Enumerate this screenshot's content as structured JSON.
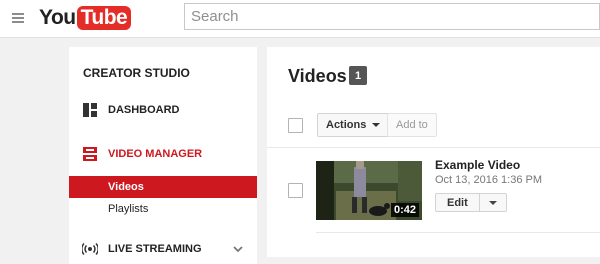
{
  "header": {
    "logo_you": "You",
    "logo_tube": "Tube",
    "search_placeholder": "Search"
  },
  "sidebar": {
    "title": "CREATOR STUDIO",
    "items": [
      {
        "label": "DASHBOARD",
        "icon": "dashboard-icon"
      },
      {
        "label": "VIDEO MANAGER",
        "icon": "video-manager-icon",
        "active": true
      },
      {
        "label": "LIVE STREAMING",
        "icon": "live-streaming-icon"
      }
    ],
    "sub_items": [
      {
        "label": "Videos",
        "selected": true
      },
      {
        "label": "Playlists"
      }
    ]
  },
  "main": {
    "title": "Videos",
    "count": "1",
    "actions_label": "Actions",
    "add_to_label": "Add to",
    "videos": [
      {
        "title": "Example Video",
        "date": "Oct 13, 2016 1:36 PM",
        "duration": "0:42",
        "edit_label": "Edit"
      }
    ]
  },
  "colors": {
    "accent": "#cc181e",
    "logo_red": "#e52d27",
    "badge": "#555555"
  }
}
